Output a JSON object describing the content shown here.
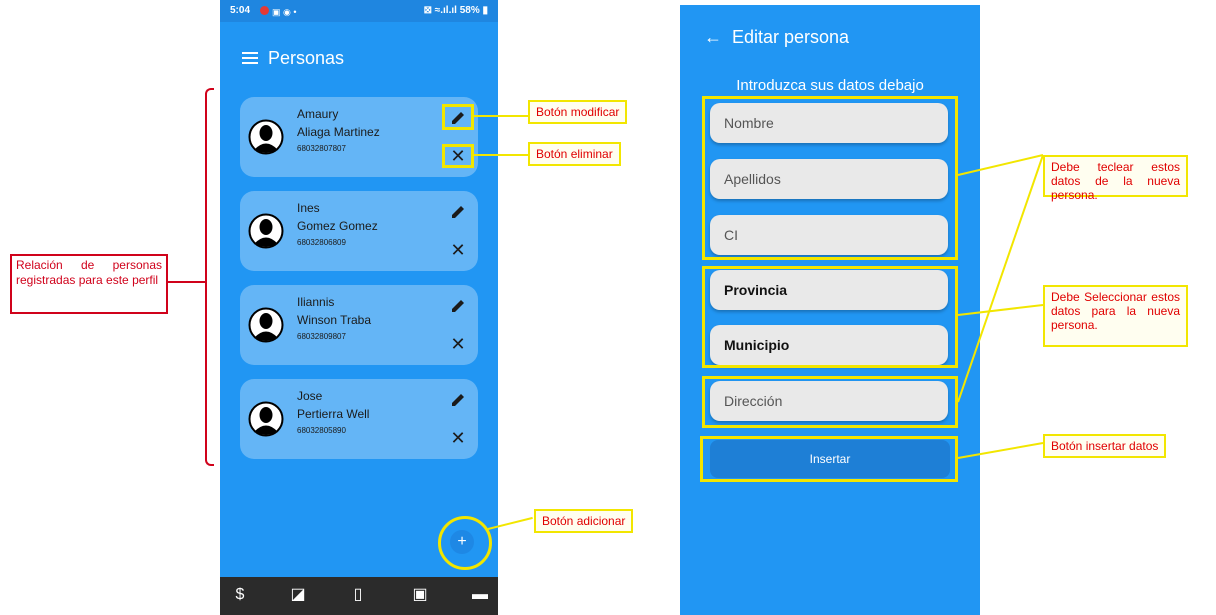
{
  "left_screen": {
    "status_bar": {
      "time": "5:04",
      "battery": "58%",
      "icons_right": "⊠ ≈.ıl.ıl"
    },
    "app_title": "Personas",
    "persons": [
      {
        "name": "Amaury",
        "surname": "Aliaga Martinez",
        "ci": "68032807807"
      },
      {
        "name": "Ines",
        "surname": "Gomez Gomez",
        "ci": "68032806809"
      },
      {
        "name": "Iliannis",
        "surname": "Winson Traba",
        "ci": "68032809807"
      },
      {
        "name": "Jose",
        "surname": "Pertierra Well",
        "ci": "68032805890"
      }
    ],
    "fab_label": "+",
    "bottom_nav_icons": [
      "dollar-icon",
      "chart-icon",
      "document-icon",
      "cash-icon",
      "card-icon"
    ]
  },
  "right_screen": {
    "title": "Editar persona",
    "subtitle": "Introduzca sus datos debajo",
    "fields": {
      "nombre": "Nombre",
      "apellidos": "Apellidos",
      "ci": "CI",
      "provincia": "Provincia",
      "municipio": "Municipio",
      "direccion": "Dirección"
    },
    "insert_label": "Insertar"
  },
  "annotations": {
    "relacion": "Relación de personas registradas para este perfil",
    "modificar": "Botón modificar",
    "eliminar": "Botón eliminar",
    "adicionar": "Botón adicionar",
    "teclear": "Debe teclear estos datos de la nueva persona.",
    "seleccionar": "Debe Seleccionar estos datos para la nueva persona.",
    "insertar": "Botón insertar datos"
  },
  "colors": {
    "primary": "#2196f3",
    "card": "#64b5f6",
    "annotation_yellow": "#f2e600",
    "annotation_red": "#d0021b"
  }
}
